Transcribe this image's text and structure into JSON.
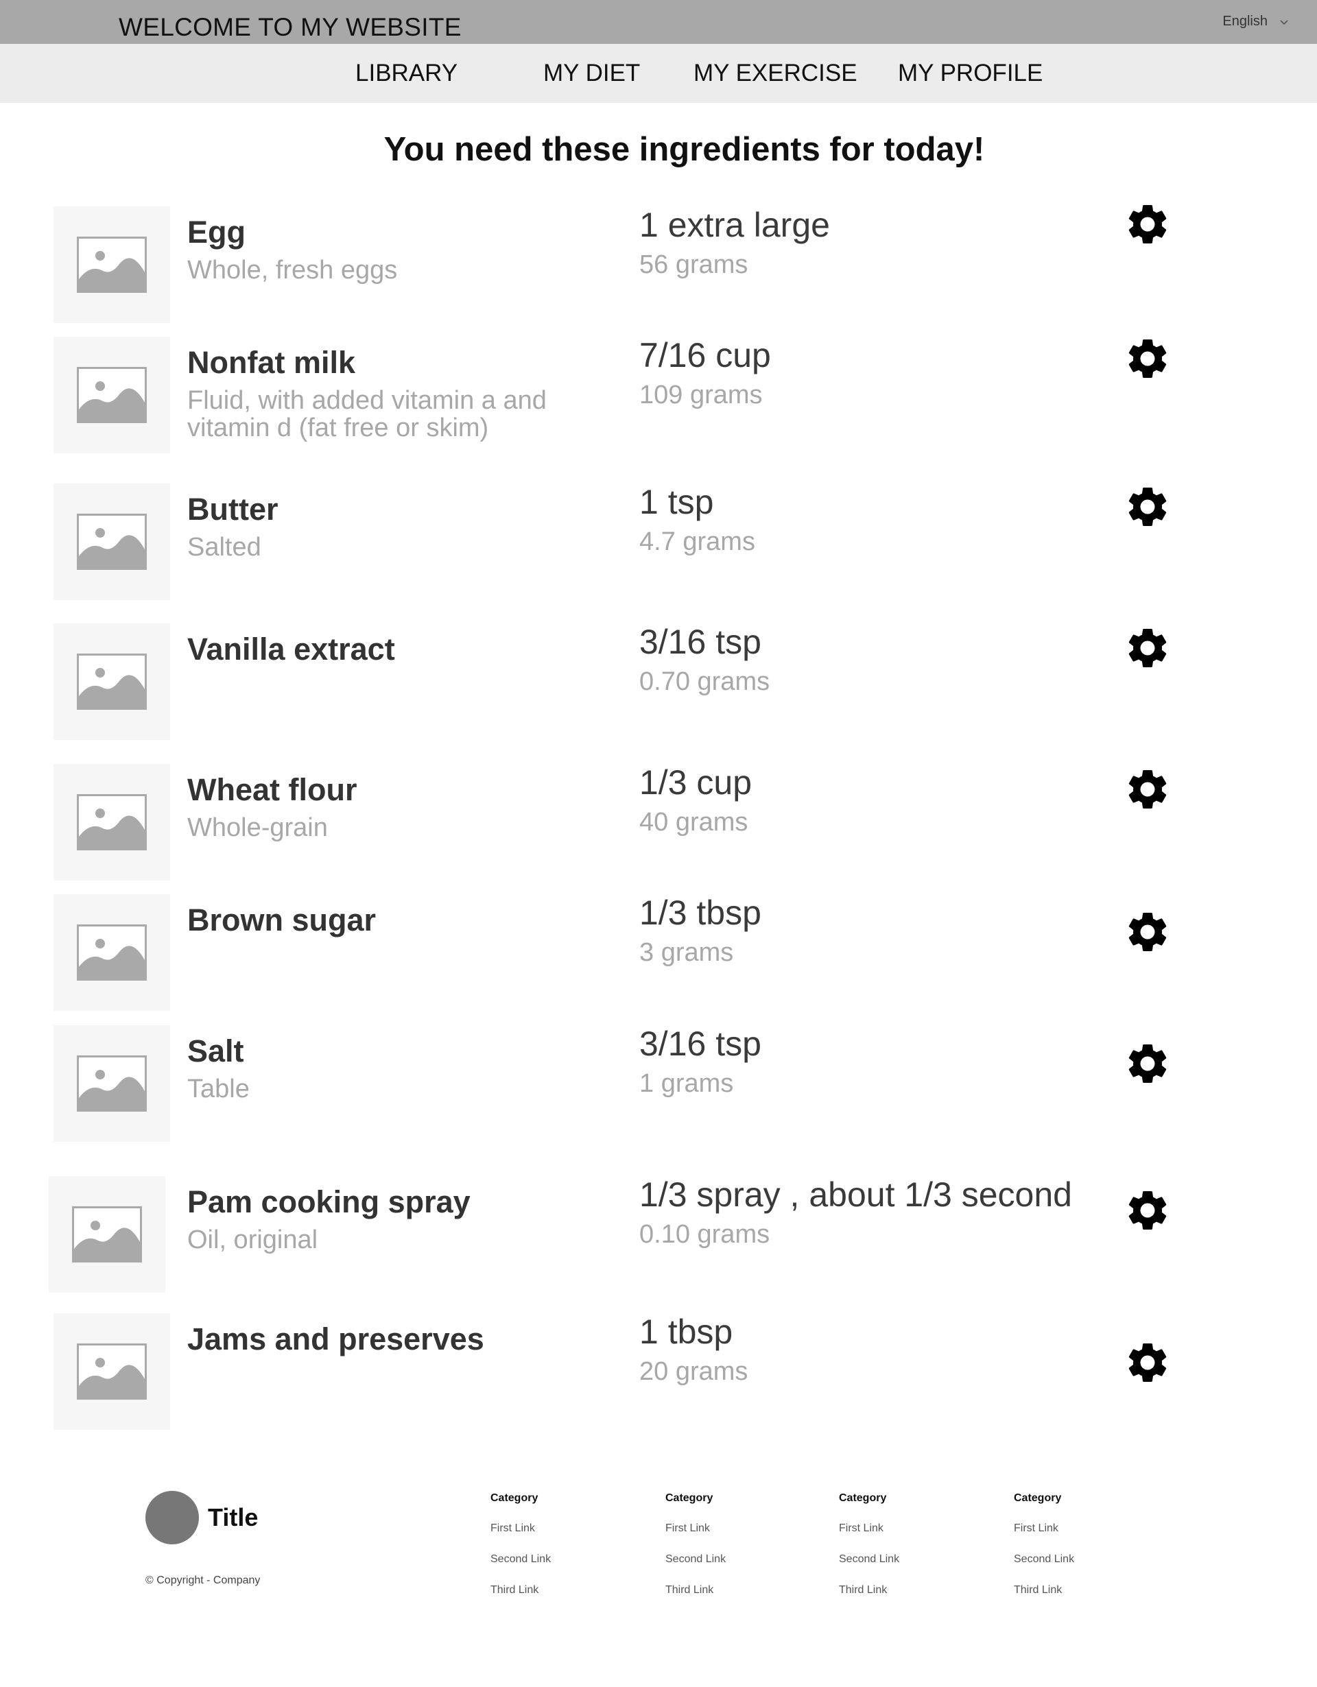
{
  "header": {
    "site_title": "WELCOME TO MY WEBSITE",
    "language": "English",
    "language_icon": "chevron-down-icon"
  },
  "nav": {
    "items": [
      "LIBRARY",
      "MY DIET",
      "MY EXERCISE",
      "MY PROFILE"
    ]
  },
  "main": {
    "heading": "You need these ingredients for today!",
    "ingredients": [
      {
        "name": "Egg",
        "description": "Whole, fresh eggs",
        "quantity": "1 extra large",
        "grams": "56 grams",
        "image_icon": "image-placeholder-icon",
        "action_icon": "gear-icon"
      },
      {
        "name": "Nonfat milk",
        "description": "Fluid, with added vitamin a and vitamin d (fat free or skim)",
        "quantity": "7/16 cup",
        "grams": "109 grams",
        "image_icon": "image-placeholder-icon",
        "action_icon": "gear-icon"
      },
      {
        "name": "Butter",
        "description": "Salted",
        "quantity": "1 tsp",
        "grams": "4.7 grams",
        "image_icon": "image-placeholder-icon",
        "action_icon": "gear-icon"
      },
      {
        "name": "Vanilla extract",
        "description": "",
        "quantity": "3/16 tsp",
        "grams": "0.70 grams",
        "image_icon": "image-placeholder-icon",
        "action_icon": "gear-icon"
      },
      {
        "name": "Wheat flour",
        "description": "Whole-grain",
        "quantity": "1/3 cup",
        "grams": "40 grams",
        "image_icon": "image-placeholder-icon",
        "action_icon": "gear-icon"
      },
      {
        "name": "Brown sugar",
        "description": "",
        "quantity": "1/3 tbsp",
        "grams": "3 grams",
        "image_icon": "image-placeholder-icon",
        "action_icon": "gear-icon"
      },
      {
        "name": "Salt",
        "description": "Table",
        "quantity": "3/16 tsp",
        "grams": "1 grams",
        "image_icon": "image-placeholder-icon",
        "action_icon": "gear-icon"
      },
      {
        "name": "Pam cooking spray",
        "description": "Oil, original",
        "quantity": "1/3 spray , about 1/3 second",
        "grams": "0.10 grams",
        "image_icon": "image-placeholder-icon",
        "action_icon": "gear-icon"
      },
      {
        "name": "Jams and preserves",
        "description": "",
        "quantity": "1 tbsp",
        "grams": "20 grams",
        "image_icon": "image-placeholder-icon",
        "action_icon": "gear-icon"
      }
    ]
  },
  "footer": {
    "brand_title": "Title",
    "copyright": "© Copyright - Company",
    "columns": [
      {
        "category": "Category",
        "links": [
          "First Link",
          "Second Link",
          "Third Link"
        ]
      },
      {
        "category": "Category",
        "links": [
          "First Link",
          "Second Link",
          "Third Link"
        ]
      },
      {
        "category": "Category",
        "links": [
          "First Link",
          "Second Link",
          "Third Link"
        ]
      },
      {
        "category": "Category",
        "links": [
          "First Link",
          "Second Link",
          "Third Link"
        ]
      }
    ]
  },
  "colors": {
    "topbar": "#a8a8a8",
    "navbar": "#ececec",
    "thumb_bg": "#f6f6f6",
    "muted_text": "#a7a7a7",
    "avatar": "#777777"
  }
}
